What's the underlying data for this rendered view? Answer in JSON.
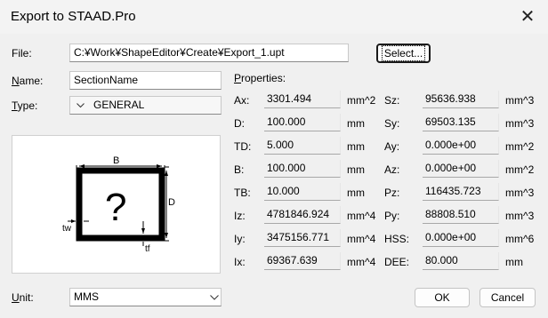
{
  "window": {
    "title": "Export to STAAD.Pro",
    "close_icon": "close-icon"
  },
  "file": {
    "label": "File:",
    "value": "C:¥Work¥ShapeEditor¥Create¥Export_1.upt",
    "select_label": "Select..."
  },
  "name": {
    "label": "Name:",
    "value": "SectionName"
  },
  "type": {
    "label": "Type:",
    "value": "GENERAL"
  },
  "preview": {
    "b_label": "B",
    "d_label": "D",
    "q_label": "?",
    "tw_label": "tw",
    "tf_label": "tf"
  },
  "unit": {
    "label": "Unit:",
    "value": "MMS"
  },
  "properties": {
    "header": "Properties:",
    "left": [
      {
        "label": "Ax:",
        "value": "3301.494",
        "unit": "mm^2"
      },
      {
        "label": "D:",
        "value": "100.000",
        "unit": "mm"
      },
      {
        "label": "TD:",
        "value": "5.000",
        "unit": "mm"
      },
      {
        "label": "B:",
        "value": "100.000",
        "unit": "mm"
      },
      {
        "label": "TB:",
        "value": "10.000",
        "unit": "mm"
      },
      {
        "label": "Iz:",
        "value": "4781846.924",
        "unit": "mm^4"
      },
      {
        "label": "Iy:",
        "value": "3475156.771",
        "unit": "mm^4"
      },
      {
        "label": "Ix:",
        "value": "69367.639",
        "unit": "mm^4"
      }
    ],
    "right": [
      {
        "label": "Sz:",
        "value": "95636.938",
        "unit": "mm^3"
      },
      {
        "label": "Sy:",
        "value": "69503.135",
        "unit": "mm^3"
      },
      {
        "label": "Ay:",
        "value": "0.000e+00",
        "unit": "mm^2"
      },
      {
        "label": "Az:",
        "value": "0.000e+00",
        "unit": "mm^2"
      },
      {
        "label": "Pz:",
        "value": "116435.723",
        "unit": "mm^3"
      },
      {
        "label": "Py:",
        "value": "88808.510",
        "unit": "mm^3"
      },
      {
        "label": "HSS:",
        "value": "0.000e+00",
        "unit": "mm^6"
      },
      {
        "label": "DEE:",
        "value": "80.000",
        "unit": "mm"
      }
    ]
  },
  "buttons": {
    "ok": "OK",
    "cancel": "Cancel"
  }
}
